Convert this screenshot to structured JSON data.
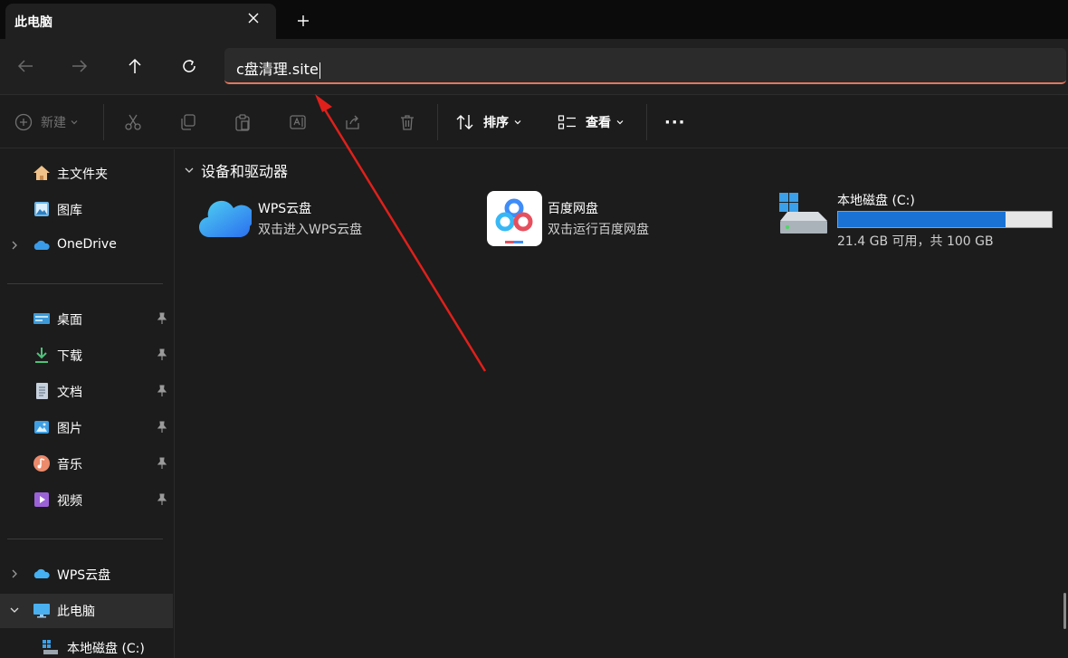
{
  "tab": {
    "title": "此电脑"
  },
  "address": {
    "value": "c盘清理.site"
  },
  "toolbar": {
    "new_label": "新建",
    "sort_label": "排序",
    "view_label": "查看",
    "more_label": "···"
  },
  "sidebar": {
    "top": [
      {
        "label": "主文件夹"
      },
      {
        "label": "图库"
      },
      {
        "label": "OneDrive"
      }
    ],
    "quick": [
      {
        "label": "桌面"
      },
      {
        "label": "下载"
      },
      {
        "label": "文档"
      },
      {
        "label": "图片"
      },
      {
        "label": "音乐"
      },
      {
        "label": "视频"
      }
    ],
    "bottom": [
      {
        "label": "WPS云盘"
      },
      {
        "label": "此电脑"
      },
      {
        "label": "本地磁盘 (C:)"
      }
    ]
  },
  "main": {
    "section_title": "设备和驱动器",
    "drives": [
      {
        "name": "WPS云盘",
        "subtitle": "双击进入WPS云盘"
      },
      {
        "name": "百度网盘",
        "subtitle": "双击运行百度网盘"
      },
      {
        "name": "本地磁盘 (C:)",
        "subtitle": "21.4 GB 可用，共 100 GB",
        "used_fraction": 0.786
      }
    ]
  },
  "colors": {
    "accent_underline": "#e3765e",
    "drive_bar": "#1a73d4",
    "annotation_arrow": "#e0201b"
  }
}
